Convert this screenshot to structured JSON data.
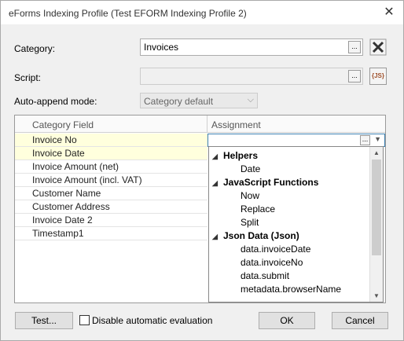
{
  "window": {
    "title": "eForms Indexing Profile (Test EFORM Indexing Profile 2)"
  },
  "category": {
    "label": "Category:",
    "value": "Invoices",
    "browse_label": "..."
  },
  "script": {
    "label": "Script:",
    "value": "",
    "browse_label": "...",
    "js_label": "{JS}"
  },
  "auto_append": {
    "label": "Auto-append mode:",
    "value": "Category default"
  },
  "grid": {
    "headers": {
      "field": "Category Field",
      "assignment": "Assignment"
    },
    "rows": [
      {
        "field": "Invoice No"
      },
      {
        "field": "Invoice Date"
      },
      {
        "field": "Invoice Amount (net)"
      },
      {
        "field": "Invoice Amount (incl. VAT)"
      },
      {
        "field": "Customer Name"
      },
      {
        "field": "Customer Address"
      },
      {
        "field": "Invoice Date 2"
      },
      {
        "field": "Timestamp1"
      }
    ],
    "selected_cell_browse": "...",
    "selected_cell_arrow": "▼"
  },
  "dropdown": {
    "groups": [
      {
        "name": "Helpers",
        "items": [
          "Date"
        ]
      },
      {
        "name": "JavaScript Functions",
        "items": [
          "Now",
          "Replace",
          "Split"
        ]
      },
      {
        "name": "Json Data (Json)",
        "items": [
          "data.invoiceDate",
          "data.invoiceNo",
          "data.submit",
          "metadata.browserName"
        ]
      }
    ]
  },
  "buttons": {
    "test": "Test...",
    "disable_eval": "Disable automatic evaluation",
    "ok": "OK",
    "cancel": "Cancel"
  }
}
